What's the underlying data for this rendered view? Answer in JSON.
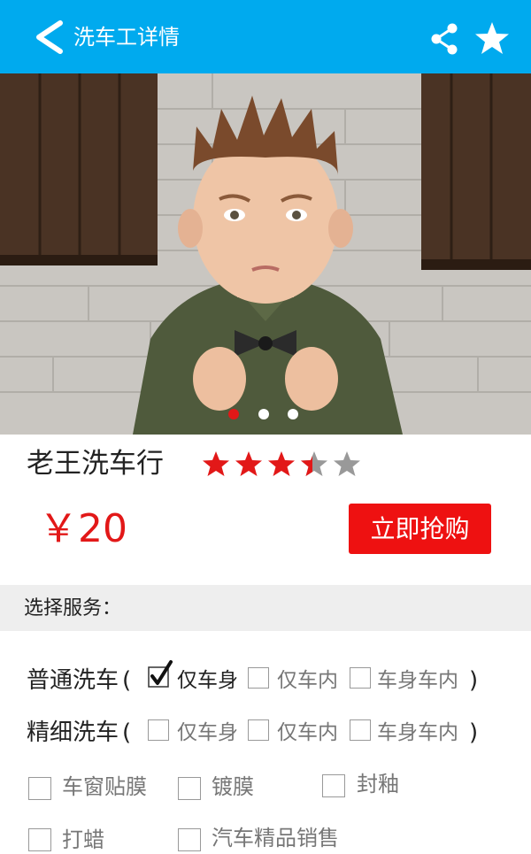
{
  "header": {
    "title": "洗车工详情",
    "icons": [
      "back-arrow-icon",
      "share-icon",
      "star-icon"
    ]
  },
  "carousel": {
    "slide_count": 3,
    "active_index": 0,
    "active_color": "#e21818"
  },
  "shop": {
    "name": "老王洗车行",
    "rating": 3.5,
    "rating_max": 5,
    "price": "￥20",
    "buy_label": "立即抢购"
  },
  "services": {
    "section_label": "选择服务：",
    "normal": {
      "label": "普通洗车",
      "open": "(",
      "close": ")",
      "options": [
        {
          "label": "仅车身",
          "checked": true
        },
        {
          "label": "仅车内",
          "checked": false
        },
        {
          "label": "车身车内",
          "checked": false
        }
      ]
    },
    "fine": {
      "label": "精细洗车",
      "open": "(",
      "close": ")",
      "options": [
        {
          "label": "仅车身",
          "checked": false
        },
        {
          "label": "仅车内",
          "checked": false
        },
        {
          "label": "车身车内",
          "checked": false
        }
      ]
    },
    "extras": [
      {
        "label": "车窗贴膜",
        "checked": false
      },
      {
        "label": "镀膜",
        "checked": false
      },
      {
        "label": "封釉",
        "checked": false
      },
      {
        "label": "打蜡",
        "checked": false
      },
      {
        "label": "汽车精品销售",
        "checked": false
      }
    ]
  },
  "colors": {
    "accent": "#00aaee",
    "price": "#e21818",
    "button": "#ee1111",
    "star": "#e21818"
  }
}
